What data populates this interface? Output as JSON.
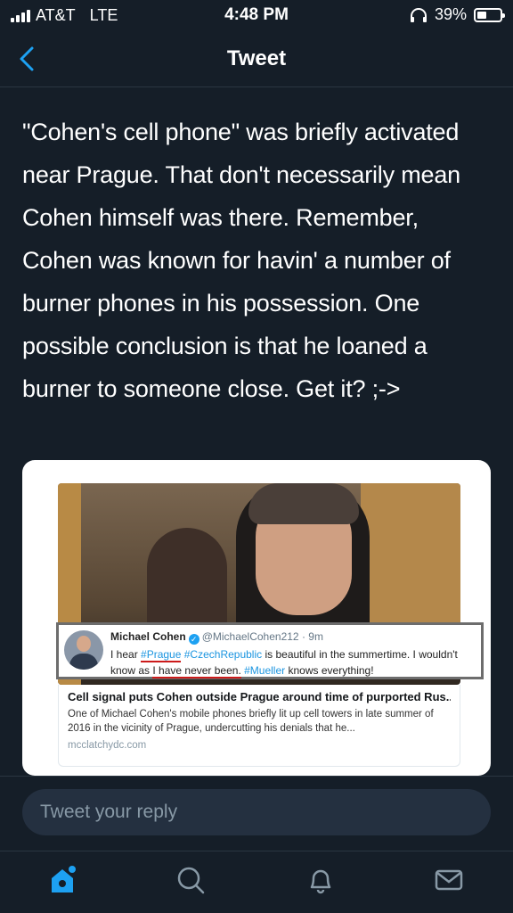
{
  "status_bar": {
    "carrier": "AT&T",
    "network": "LTE",
    "time": "4:48 PM",
    "battery": "39%",
    "battery_level": 0.39
  },
  "nav": {
    "title": "Tweet",
    "back_icon": "chevron-left-icon"
  },
  "tweet": {
    "text": "\"Cohen's cell phone\" was briefly activated near Prague.  That don't necessarily mean Cohen himself was there.  Remember, Cohen was known for havin' a number of burner phones in his possession.  One possible conclusion is that he loaned a burner to someone close.  Get it?  ;->"
  },
  "embedded_image": {
    "quoted_tweet": {
      "name": "Michael Cohen",
      "handle": "@MichaelCohen212",
      "time": "9m",
      "text_1": "I hear",
      "tag_1": "#Prague",
      "tag_2": "#CzechRepublic",
      "text_2": "is beautiful in the summertime. I wouldn't know as",
      "text_3": "I have never been.",
      "tag_3": "#Mueller",
      "text_4": "knows everything!"
    },
    "link_card": {
      "title_1": "Cell signal puts Cohen",
      "title_2": "outside Prague",
      "title_3": "around time of purported Rus...",
      "description": "One of Michael Cohen's mobile phones briefly lit up cell towers in late summer of 2016 in the vicinity of Prague, undercutting his denials that he...",
      "domain": "mcclatchydc.com"
    }
  },
  "reply": {
    "placeholder": "Tweet your reply"
  },
  "tabs": [
    {
      "icon": "home-icon",
      "active": true
    },
    {
      "icon": "search-icon",
      "active": false
    },
    {
      "icon": "bell-icon",
      "active": false
    },
    {
      "icon": "mail-icon",
      "active": false
    }
  ],
  "colors": {
    "background": "#151e28",
    "accent": "#1da1f2",
    "muted": "#8899a6"
  }
}
